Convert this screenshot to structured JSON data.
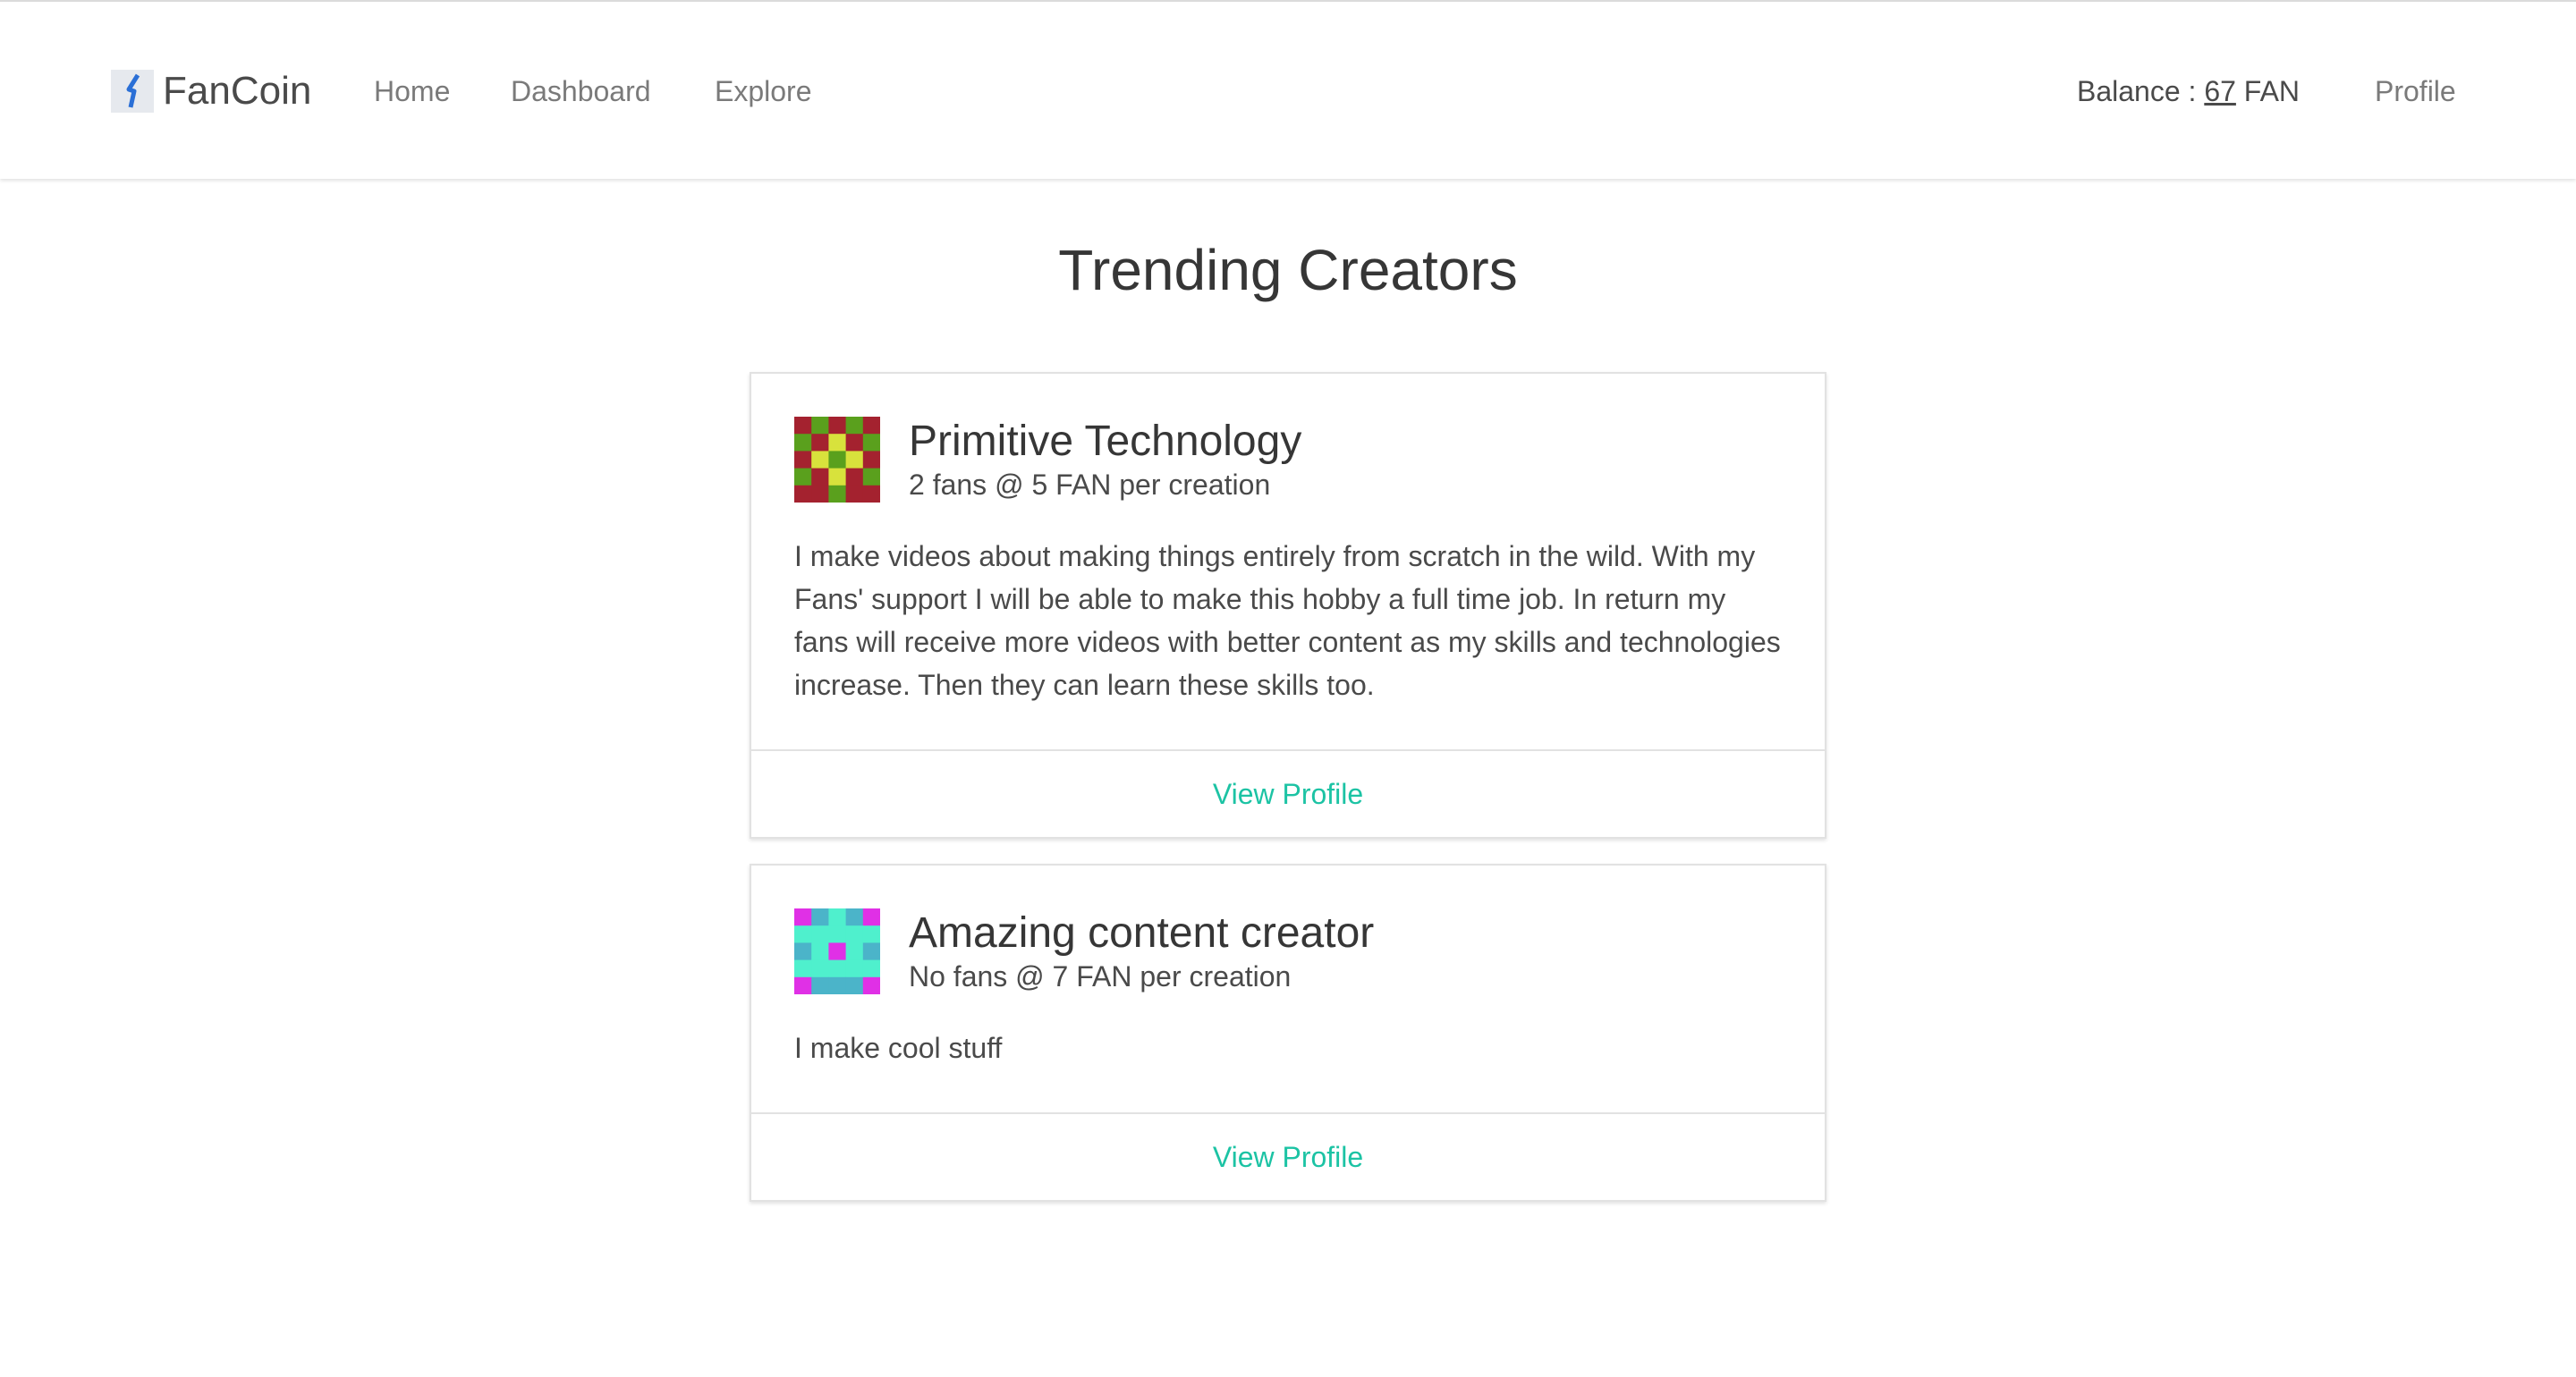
{
  "nav": {
    "brand": "FanCoin",
    "links": [
      "Home",
      "Dashboard",
      "Explore"
    ],
    "balance_prefix": "Balance : ",
    "balance_amount": "67",
    "balance_unit": " FAN",
    "profile": "Profile"
  },
  "page": {
    "title": "Trending Creators"
  },
  "creators": [
    {
      "name": "Primitive Technology",
      "subtitle": "2 fans @ 5 FAN per creation",
      "bio": "I make videos about making things entirely from scratch in the wild. With my Fans' support I will be able to make this hobby a full time job. In return my fans will receive more videos with better content as my skills and technologies increase. Then they can learn these skills too.",
      "link": "View Profile",
      "avatar_colors": [
        "#a4222f",
        "#5aa01d",
        "#d8e23c"
      ]
    },
    {
      "name": "Amazing content creator",
      "subtitle": "No fans @ 7 FAN per creation",
      "bio": "I make cool stuff",
      "link": "View Profile",
      "avatar_colors": [
        "#4bb4c9",
        "#4ff0cd",
        "#e030e6"
      ]
    }
  ],
  "colors": {
    "link": "#1cc3a4",
    "brand_icon": "#2a6fd6"
  }
}
